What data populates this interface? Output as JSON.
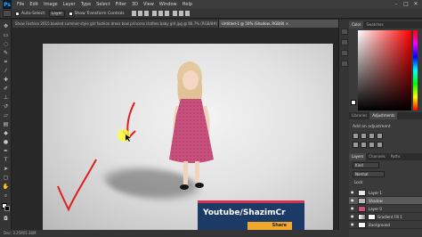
{
  "app": {
    "logo": "Ps"
  },
  "menubar": {
    "items": [
      "File",
      "Edit",
      "Image",
      "Layer",
      "Type",
      "Select",
      "Filter",
      "3D",
      "View",
      "Window",
      "Help"
    ],
    "window_controls": [
      "–",
      "□",
      "✕"
    ]
  },
  "options": {
    "auto_select_label": "Auto-Select:",
    "auto_select_value": "Layer",
    "show_transform_label": "Show Transform Controls"
  },
  "tabs": [
    {
      "label": "Show Fashion 2015 bowled summer-style girl fashion dress bow princess clothes baby girl.jpg @ 66.7% (RGB/8#) ×"
    },
    {
      "label": "Untitled-1 @ 50% (Shadow, RGB/8) ×",
      "active": true
    }
  ],
  "canvas": {
    "overlay_title": "Youtube/ShazimCr",
    "overlay_share": "Share"
  },
  "status": {
    "text": "Doc: 3.25M/5.38M"
  },
  "panels": {
    "color_tabs": [
      "Color",
      "Swatches"
    ],
    "adjust_tabs": [
      "Libraries",
      "Adjustments"
    ],
    "adjust_label": "Add an adjustment",
    "layer_tabs": [
      "Layers",
      "Channels",
      "Paths"
    ],
    "kind_label": "Kind",
    "blend_mode": "Normal",
    "lock_label": "Lock:",
    "layers": [
      {
        "name": "Layer 1",
        "selected": false
      },
      {
        "name": "Shadow",
        "selected": true
      },
      {
        "name": "Layer 0",
        "selected": false
      },
      {
        "name": "Gradient Fill 1",
        "selected": false
      },
      {
        "name": "Background",
        "selected": false
      }
    ]
  },
  "colors": {
    "accent_blue": "#31a8ff",
    "dress": "#c94f7c",
    "overlay_bg": "#1c3a66",
    "overlay_bar": "#d93050",
    "share_btn": "#f0a92e",
    "arrows": "#e02020"
  }
}
